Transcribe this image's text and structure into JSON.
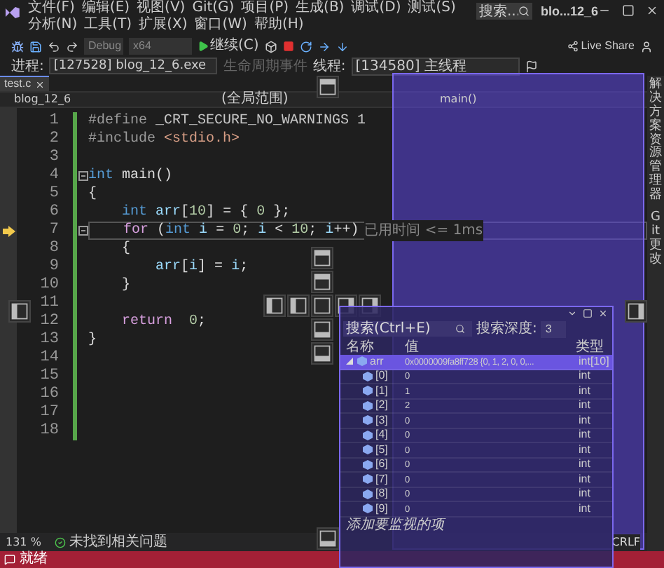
{
  "menu": [
    "文件(F)",
    "编辑(E)",
    "视图(V)",
    "Git(G)",
    "项目(P)",
    "生成(B)",
    "调试(D)",
    "测试(S)",
    "分析(N)",
    "工具(T)",
    "扩展(X)",
    "窗口(W)",
    "帮助(H)"
  ],
  "search": {
    "placeholder": "搜索..."
  },
  "window": {
    "title": "blo...12_6"
  },
  "toolbar": {
    "configuration": "Debug",
    "platform": "x64",
    "continue": "继续(C)",
    "live_share": "Live Share"
  },
  "debug_bar": {
    "process_label": "进程:",
    "process": "[127528] blog_12_6.exe",
    "lifecycle": "生命周期事件",
    "thread_label": "线程:",
    "thread": "[134580] 主线程"
  },
  "tabs": [
    {
      "label": "test.c",
      "selected": true
    }
  ],
  "nav": {
    "project": "blog_12_6",
    "scope": "(全局范围)",
    "member": "main()"
  },
  "code": [
    {
      "n": "1",
      "tokens": [
        {
          "t": "#define ",
          "kind": "preproc"
        },
        {
          "t": "_CRT_SECURE_NO_WARNINGS 1",
          "kind": "macro"
        }
      ]
    },
    {
      "n": "2",
      "tokens": [
        {
          "t": "#include ",
          "kind": "preproc"
        },
        {
          "t": "<stdio.h>",
          "kind": "string"
        }
      ]
    },
    {
      "n": "3"
    },
    {
      "n": "4",
      "fold": true,
      "tokens": [
        {
          "t": "int ",
          "kind": "type"
        },
        {
          "t": "main()",
          "kind": "plain"
        }
      ]
    },
    {
      "n": "5",
      "tokens": [
        {
          "t": "{",
          "kind": "plain"
        }
      ]
    },
    {
      "n": "6",
      "tokens": [
        {
          "t": "    int ",
          "kind": "type"
        },
        {
          "t": "arr",
          "kind": "var"
        },
        {
          "t": "[",
          "kind": "plain"
        },
        {
          "t": "10",
          "kind": "number"
        },
        {
          "t": "] = { ",
          "kind": "plain"
        },
        {
          "t": "0",
          "kind": "number"
        },
        {
          "t": " };",
          "kind": "plain"
        }
      ]
    },
    {
      "n": "7",
      "fold": true,
      "current": true,
      "hint": "已用时间 <= 1ms",
      "tokens": [
        {
          "t": "    for",
          "kind": "control"
        },
        {
          "t": " (",
          "kind": "plain"
        },
        {
          "t": "int ",
          "kind": "type"
        },
        {
          "t": "i",
          "kind": "var"
        },
        {
          "t": " = ",
          "kind": "plain"
        },
        {
          "t": "0",
          "kind": "number"
        },
        {
          "t": "; ",
          "kind": "plain"
        },
        {
          "t": "i",
          "kind": "var"
        },
        {
          "t": " < ",
          "kind": "plain"
        },
        {
          "t": "10",
          "kind": "number"
        },
        {
          "t": "; ",
          "kind": "plain"
        },
        {
          "t": "i",
          "kind": "var"
        },
        {
          "t": "++)",
          "kind": "plain"
        }
      ]
    },
    {
      "n": "8",
      "tokens": [
        {
          "t": "    {",
          "kind": "plain"
        }
      ]
    },
    {
      "n": "9",
      "tokens": [
        {
          "t": "        arr",
          "kind": "var"
        },
        {
          "t": "[",
          "kind": "plain"
        },
        {
          "t": "i",
          "kind": "var"
        },
        {
          "t": "] = ",
          "kind": "plain"
        },
        {
          "t": "i",
          "kind": "var"
        },
        {
          "t": ";",
          "kind": "plain"
        }
      ]
    },
    {
      "n": "10",
      "tokens": [
        {
          "t": "    }",
          "kind": "plain"
        }
      ]
    },
    {
      "n": "11"
    },
    {
      "n": "12",
      "tokens": [
        {
          "t": "    return",
          "kind": "control"
        },
        {
          "t": "  0",
          "kind": "number"
        },
        {
          "t": ";",
          "kind": "plain"
        }
      ]
    },
    {
      "n": "13",
      "tokens": [
        {
          "t": "}",
          "kind": "plain"
        }
      ]
    },
    {
      "n": "14"
    },
    {
      "n": "15"
    },
    {
      "n": "16"
    },
    {
      "n": "17"
    },
    {
      "n": "18"
    }
  ],
  "editor_status": {
    "zoom": "131 %",
    "issues": "未找到相关问题",
    "line_ending": "CRLF"
  },
  "status_bar": {
    "text": "就绪"
  },
  "side_tabs": [
    "解决方案资源管理器",
    "Git 更改"
  ],
  "watch": {
    "search": {
      "placeholder": "搜索(Ctrl+E)"
    },
    "depth_label": "搜索深度:",
    "depth": "3",
    "columns": [
      "名称",
      "值",
      "类型"
    ],
    "rows": [
      {
        "name": "arr",
        "value": "0x0000009fa8ff728 {0, 1, 2, 0, 0,...",
        "type": "int[10]",
        "selected": true,
        "expanded": true,
        "children": [
          {
            "name": "[0]",
            "value": "0",
            "type": "int",
            "selected": false
          },
          {
            "name": "[1]",
            "value": "1",
            "type": "int",
            "selected": false
          },
          {
            "name": "[2]",
            "value": "2",
            "type": "int",
            "selected": false
          },
          {
            "name": "[3]",
            "value": "0",
            "type": "int",
            "selected": false
          },
          {
            "name": "[4]",
            "value": "0",
            "type": "int",
            "selected": false
          },
          {
            "name": "[5]",
            "value": "0",
            "type": "int",
            "selected": false
          },
          {
            "name": "[6]",
            "value": "0",
            "type": "int",
            "selected": false
          },
          {
            "name": "[7]",
            "value": "0",
            "type": "int",
            "selected": false
          },
          {
            "name": "[8]",
            "value": "0",
            "type": "int",
            "selected": false
          },
          {
            "name": "[9]",
            "value": "0",
            "type": "int",
            "selected": false
          }
        ]
      }
    ],
    "add_item": "添加要监视的项"
  }
}
